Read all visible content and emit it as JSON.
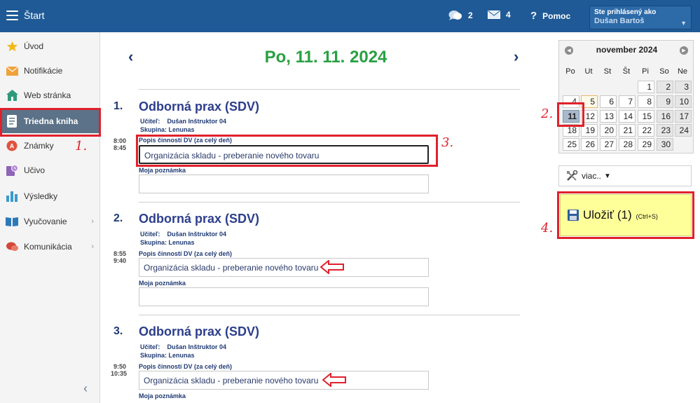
{
  "topbar": {
    "app_title": "Štart",
    "messages_count": "2",
    "mail_count": "4",
    "help_label": "Pomoc",
    "user_label": "Ste prihlásený ako",
    "user_name": "Dušan Bartoš"
  },
  "sidebar": {
    "items": [
      {
        "label": "Úvod",
        "icon": "star-icon"
      },
      {
        "label": "Notifikácie",
        "icon": "envelope-icon"
      },
      {
        "label": "Web stránka",
        "icon": "home-icon"
      },
      {
        "label": "Triedna kniha",
        "icon": "notebook-icon"
      },
      {
        "label": "Známky",
        "icon": "grade-icon"
      },
      {
        "label": "Učivo",
        "icon": "book-clock-icon"
      },
      {
        "label": "Výsledky",
        "icon": "bar-chart-icon"
      },
      {
        "label": "Vyučovanie",
        "icon": "open-book-icon"
      },
      {
        "label": "Komunikácia",
        "icon": "chat-icon"
      }
    ]
  },
  "annotations": {
    "n1": "1.",
    "n2": "2.",
    "n3": "3.",
    "n4": "4."
  },
  "main": {
    "date": "Po, 11. 11. 2024",
    "lessons": [
      {
        "num": "1.",
        "name": "Odborná prax (SDV)",
        "teacher_label": "Učiteľ:",
        "teacher": "Dušan Inštruktor 04",
        "group_label": "Skupina:",
        "group": "Lenunas",
        "time_from": "8:00",
        "time_to": "8:45",
        "activity_label": "Popis činností DV (za celý deň)",
        "activity_value": "Organizácia skladu - preberanie nového tovaru",
        "note_label": "Moja poznámka"
      },
      {
        "num": "2.",
        "name": "Odborná prax (SDV)",
        "teacher_label": "Učiteľ:",
        "teacher": "Dušan Inštruktor 04",
        "group_label": "Skupina:",
        "group": "Lenunas",
        "time_from": "8:55",
        "time_to": "9:40",
        "activity_label": "Popis činností DV (za celý deň)",
        "activity_value": "Organizácia skladu - preberanie nového tovaru",
        "note_label": "Moja poznámka"
      },
      {
        "num": "3.",
        "name": "Odborná prax (SDV)",
        "teacher_label": "Učiteľ:",
        "teacher": "Dušan Inštruktor 04",
        "group_label": "Skupina:",
        "group": "Lenunas",
        "time_from": "9:50",
        "time_to": "10:35",
        "activity_label": "Popis činností DV (za celý deň)",
        "activity_value": "Organizácia skladu - preberanie nového tovaru",
        "note_label": "Moja poznámka"
      }
    ]
  },
  "calendar": {
    "month": "november 2024",
    "weekdays": [
      "Po",
      "Ut",
      "St",
      "Št",
      "Pi",
      "So",
      "Ne"
    ],
    "days": [
      [
        "",
        "",
        "",
        "",
        "1",
        "2",
        "3"
      ],
      [
        "4",
        "5",
        "6",
        "7",
        "8",
        "9",
        "10"
      ],
      [
        "11",
        "12",
        "13",
        "14",
        "15",
        "16",
        "17"
      ],
      [
        "18",
        "19",
        "20",
        "21",
        "22",
        "23",
        "24"
      ],
      [
        "25",
        "26",
        "27",
        "28",
        "29",
        "30",
        ""
      ]
    ],
    "selected": "11",
    "today": "5"
  },
  "actions": {
    "more_label": "viac..",
    "save_label": "Uložiť (1)",
    "save_shortcut": "(Ctrl+S)"
  },
  "colors": {
    "topbar": "#1f5a96",
    "date_green": "#2aa043",
    "annotation_red": "#e0212b",
    "save_yellow": "#ffff9a"
  }
}
